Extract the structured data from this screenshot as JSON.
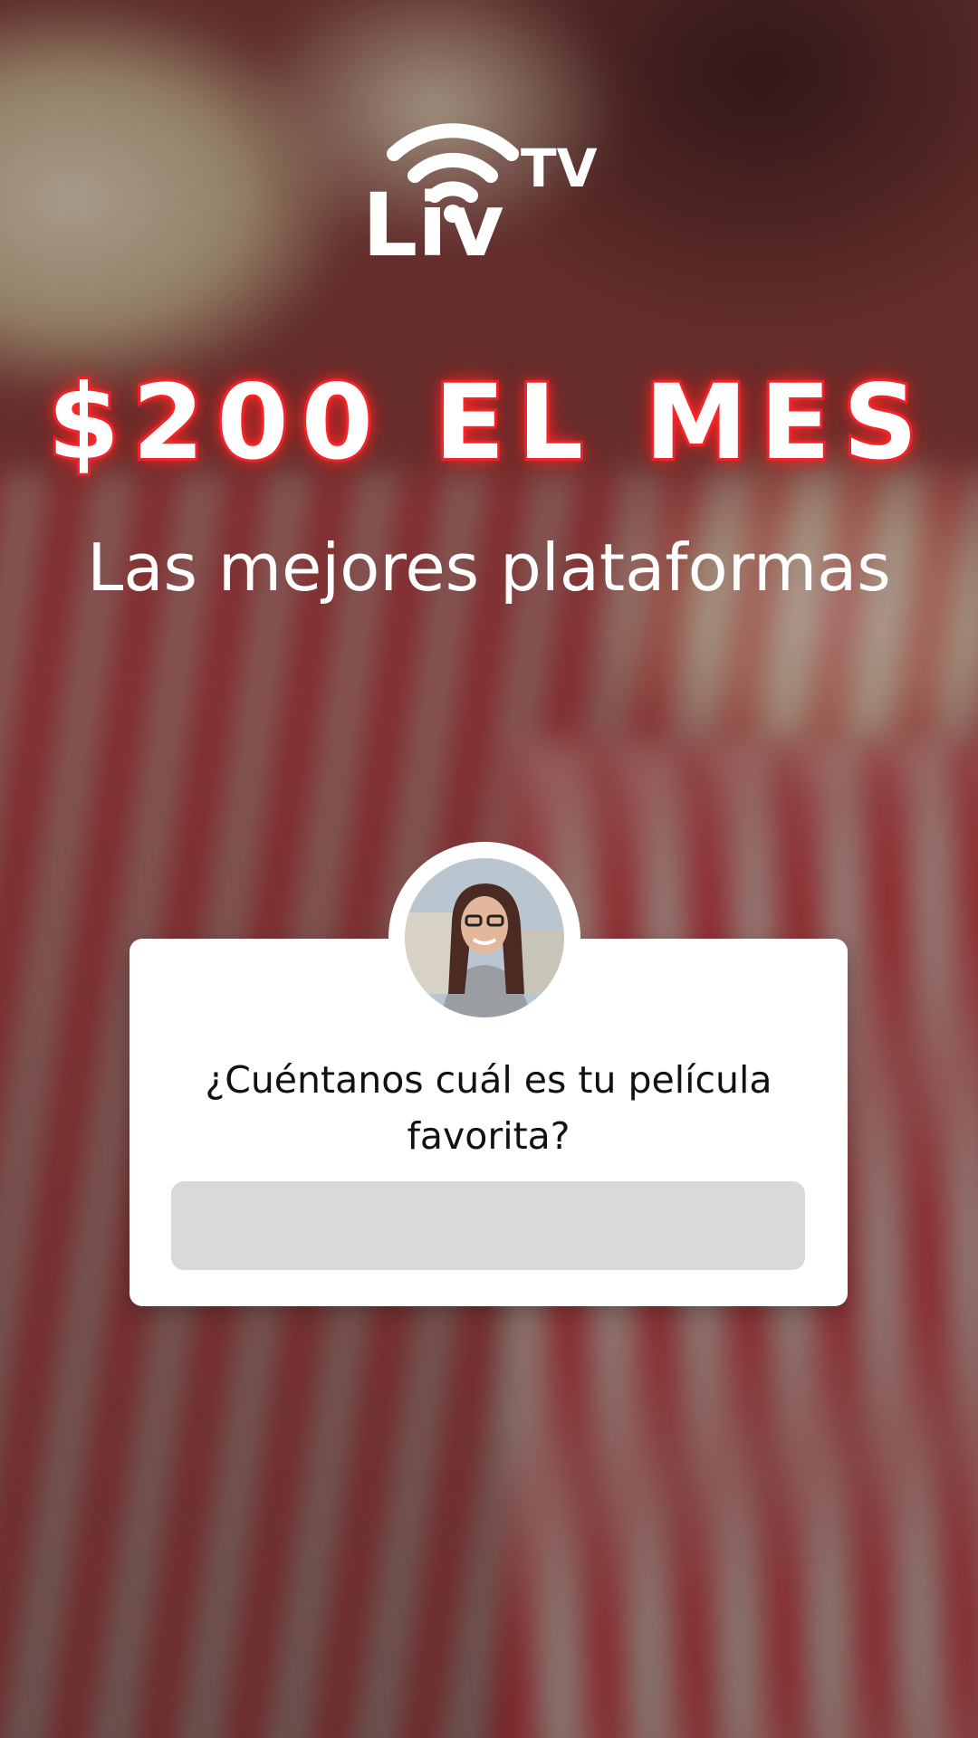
{
  "brand": {
    "logo_text": "Liv",
    "logo_superscript": "TV",
    "logo_icon": "wifi-icon"
  },
  "promo": {
    "price_text": "$200 EL MES",
    "tagline": "Las mejores plataformas"
  },
  "question_card": {
    "question": "¿Cuéntanos cuál es tu película favorita?",
    "answer_placeholder": "",
    "avatar": "user-avatar"
  },
  "colors": {
    "neon_red": "#e02230",
    "card_bg": "#ffffff",
    "input_bg": "#d9d9d9"
  }
}
